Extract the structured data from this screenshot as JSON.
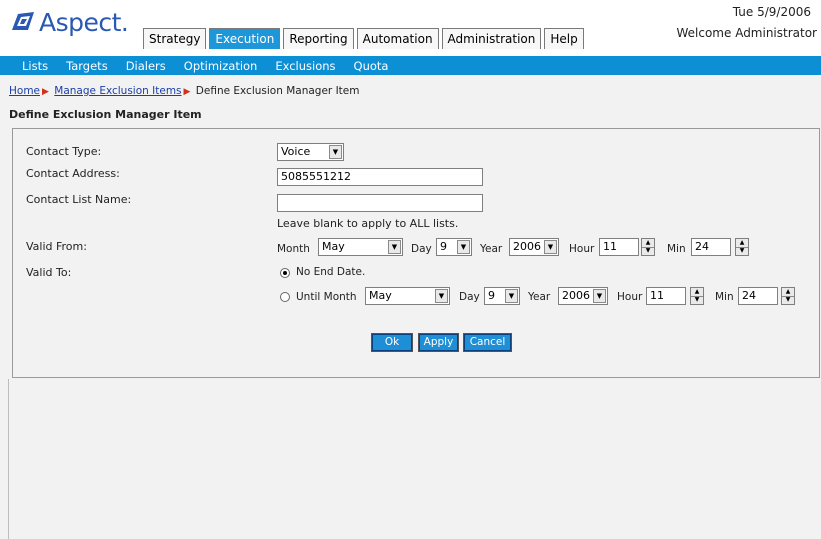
{
  "app": {
    "logo_text": "Aspect.",
    "date": "Tue 5/9/2006",
    "welcome": "Welcome Administrator"
  },
  "tabs": [
    {
      "label": "Strategy"
    },
    {
      "label": "Execution",
      "active": true
    },
    {
      "label": "Reporting"
    },
    {
      "label": "Automation"
    },
    {
      "label": "Administration"
    },
    {
      "label": "Help"
    }
  ],
  "subnav": [
    "Lists",
    "Targets",
    "Dialers",
    "Optimization",
    "Exclusions",
    "Quota"
  ],
  "breadcrumb": {
    "home": "Home",
    "manage": "Manage Exclusion Items",
    "current": "Define Exclusion Manager Item"
  },
  "page_title": "Define Exclusion Manager Item",
  "form": {
    "contact_type_label": "Contact Type:",
    "contact_type_value": "Voice",
    "contact_address_label": "Contact Address:",
    "contact_address_value": "5085551212",
    "contact_list_label": "Contact List Name:",
    "contact_list_value": "",
    "contact_list_hint": "Leave blank to apply to ALL lists.",
    "valid_from_label": "Valid From:",
    "valid_to_label": "Valid To:",
    "from": {
      "month_label": "Month",
      "month": "May",
      "day_label": "Day",
      "day": "9",
      "year_label": "Year",
      "year": "2006",
      "hour_label": "Hour",
      "hour": "11",
      "min_label": "Min",
      "min": "24"
    },
    "no_end_label": "No End Date.",
    "until": {
      "month_label": "Until Month",
      "month": "May",
      "day_label": "Day",
      "day": "9",
      "year_label": "Year",
      "year": "2006",
      "hour_label": "Hour",
      "hour": "11",
      "min_label": "Min",
      "min": "24"
    }
  },
  "buttons": {
    "ok": "Ok",
    "apply": "Apply",
    "cancel": "Cancel"
  },
  "colors": {
    "accent": "#1e97d9",
    "subnav": "#0d8fd6",
    "logo": "#2a58b3"
  }
}
